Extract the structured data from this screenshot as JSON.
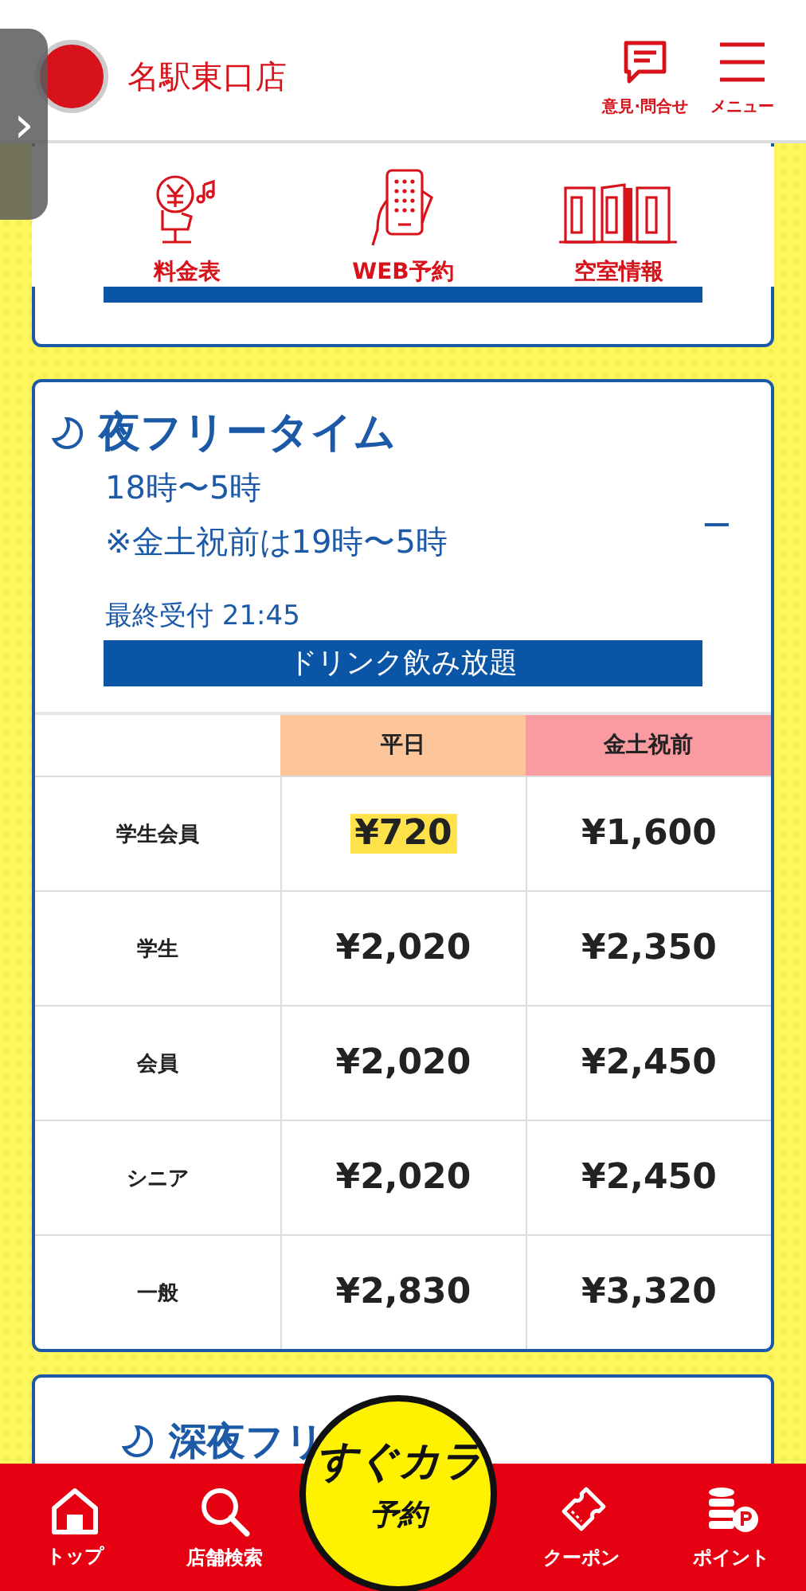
{
  "header": {
    "store_name": "名駅東口店",
    "actions": [
      {
        "label": "意見·問合せ"
      },
      {
        "label": "メニュー"
      }
    ]
  },
  "side_tab": {
    "glyph": "›"
  },
  "shortcuts": [
    {
      "label": "料金表"
    },
    {
      "label": "WEB予約"
    },
    {
      "label": "空室情報"
    }
  ],
  "plans": [
    {
      "title": "夜フリータイム",
      "times": [
        "18時〜5時",
        "※金土祝前は19時〜5時"
      ],
      "toggle": "−",
      "last_order": "最終受付 21:45",
      "drink": "ドリンク飲み放題",
      "table": {
        "columns": [
          "平日",
          "金土祝前"
        ],
        "rows": [
          {
            "label": "学生会員",
            "cells": [
              {
                "text": "¥720",
                "highlighted": true
              },
              {
                "text": "¥1,600",
                "highlighted": false
              }
            ]
          },
          {
            "label": "学生",
            "cells": [
              {
                "text": "¥2,020",
                "highlighted": false
              },
              {
                "text": "¥2,350",
                "highlighted": false
              }
            ]
          },
          {
            "label": "会員",
            "cells": [
              {
                "text": "¥2,020",
                "highlighted": false
              },
              {
                "text": "¥2,450",
                "highlighted": false
              }
            ]
          },
          {
            "label": "シニア",
            "cells": [
              {
                "text": "¥2,020",
                "highlighted": false
              },
              {
                "text": "¥2,450",
                "highlighted": false
              }
            ]
          },
          {
            "label": "一般",
            "cells": [
              {
                "text": "¥2,830",
                "highlighted": false
              },
              {
                "text": "¥3,320",
                "highlighted": false
              }
            ]
          }
        ]
      }
    },
    {
      "title": "深夜フリ"
    }
  ],
  "bottom_nav": [
    {
      "kind": "item",
      "label": "トップ"
    },
    {
      "kind": "item",
      "label": "店舗検索"
    },
    {
      "kind": "center",
      "label": "すぐカラ",
      "sub": "予約"
    },
    {
      "kind": "item",
      "label": "クーポン"
    },
    {
      "kind": "item",
      "label": "ポイント"
    }
  ]
}
